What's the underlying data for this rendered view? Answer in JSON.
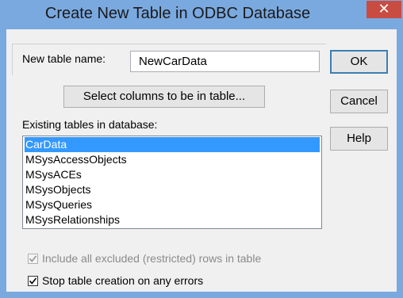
{
  "window": {
    "title": "Create New Table in ODBC Database",
    "close_glyph": "✕"
  },
  "name_field": {
    "label": "New table name:",
    "value": "NewCarData"
  },
  "select_columns_button": "Select columns to be in table...",
  "existing_tables": {
    "label": "Existing tables in database:",
    "items": [
      {
        "label": "CarData",
        "selected": true
      },
      {
        "label": "MSysAccessObjects",
        "selected": false
      },
      {
        "label": "MSysACEs",
        "selected": false
      },
      {
        "label": "MSysObjects",
        "selected": false
      },
      {
        "label": "MSysQueries",
        "selected": false
      },
      {
        "label": "MSysRelationships",
        "selected": false
      }
    ]
  },
  "buttons": {
    "ok": "OK",
    "cancel": "Cancel",
    "help": "Help"
  },
  "options": {
    "include_excluded": {
      "label": "Include all excluded (restricted) rows in table",
      "checked": true,
      "enabled": false
    },
    "stop_on_errors": {
      "label": "Stop table creation on any errors",
      "checked": true,
      "enabled": true
    }
  },
  "colors": {
    "titlebar": "#7aa9e0",
    "close_button": "#c94c43",
    "selection": "#3399ff"
  }
}
